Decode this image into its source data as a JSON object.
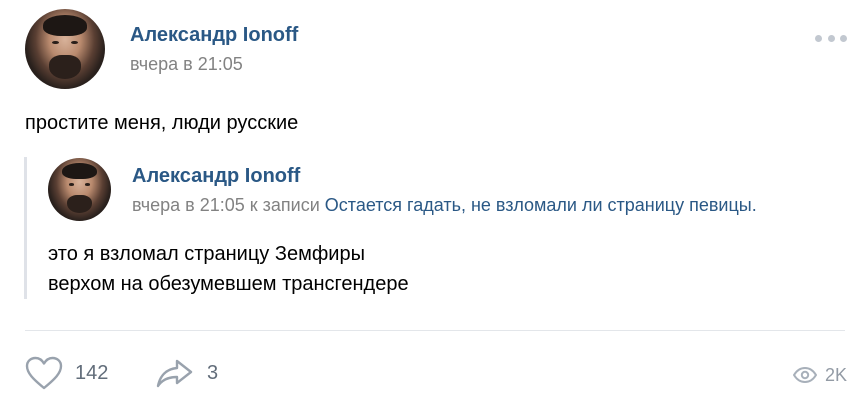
{
  "post": {
    "author": "Александр Ionoff",
    "time": "вчера в 21:05",
    "text": "простите меня, люди русские"
  },
  "repost": {
    "author": "Александр Ionoff",
    "time": "вчера в 21:05",
    "to_post_prefix": " к записи ",
    "to_post_link": "Остается гадать, не взломали ли страницу певицы.",
    "lines": [
      "это я взломал страницу Земфиры",
      "верхом на обезумевшем трансгендере"
    ]
  },
  "footer": {
    "likes": "142",
    "shares": "3",
    "views": "2K"
  },
  "icons": {
    "more": "more-dots-icon",
    "like": "heart-icon",
    "share": "share-arrow-icon",
    "views": "eye-icon"
  },
  "colors": {
    "link": "#2a5885",
    "meta": "#828282",
    "action": "#626d7a"
  }
}
